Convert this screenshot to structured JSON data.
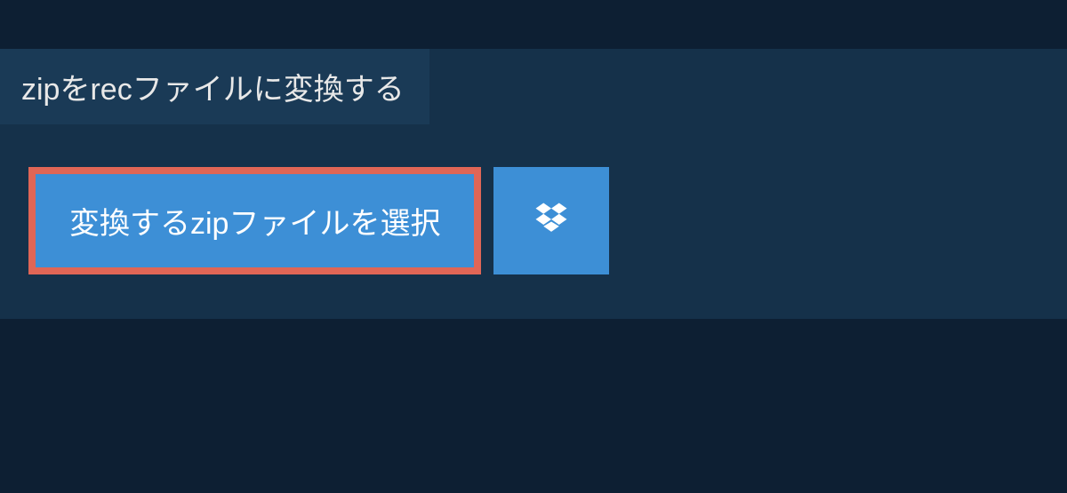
{
  "title": "zipをrecファイルに変換する",
  "select_button_label": "変換するzipファイルを選択",
  "colors": {
    "bg": "#0d1f33",
    "panel": "#15314a",
    "tab": "#1a3a56",
    "button": "#3d8fd6",
    "highlight_border": "#e06656"
  }
}
